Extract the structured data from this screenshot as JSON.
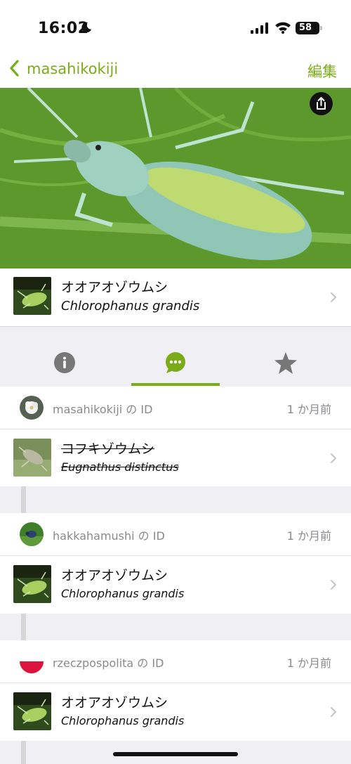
{
  "status_bar": {
    "time": "16:02",
    "battery": "58"
  },
  "nav": {
    "back_label": "masahikokiji",
    "edit_label": "編集"
  },
  "photo": {
    "subject": "green weevil on leaf"
  },
  "taxon": {
    "common_name": "オオアオゾウムシ",
    "scientific_name": "Chlorophanus grandis"
  },
  "tabs": [
    {
      "icon": "info-icon",
      "active": false
    },
    {
      "icon": "comment-icon",
      "active": true
    },
    {
      "icon": "star-icon",
      "active": false
    }
  ],
  "identifications": [
    {
      "user": "masahikokiji",
      "suffix": " の ID",
      "time": "1 か月前",
      "common_name": "コフキゾウムシ",
      "scientific_name": "Eugnathus distinctus",
      "withdrawn": true
    },
    {
      "user": "hakkahamushi",
      "suffix": " の ID",
      "time": "1 か月前",
      "common_name": "オオアオゾウムシ",
      "scientific_name": "Chlorophanus grandis",
      "withdrawn": false
    },
    {
      "user": "rzeczpospolita",
      "suffix": " の ID",
      "time": "1 か月前",
      "common_name": "オオアオゾウムシ",
      "scientific_name": "Chlorophanus grandis",
      "withdrawn": false
    }
  ],
  "colors": {
    "accent": "#7aac17",
    "muted_text": "#8a8a8e",
    "background": "#efeff4"
  }
}
